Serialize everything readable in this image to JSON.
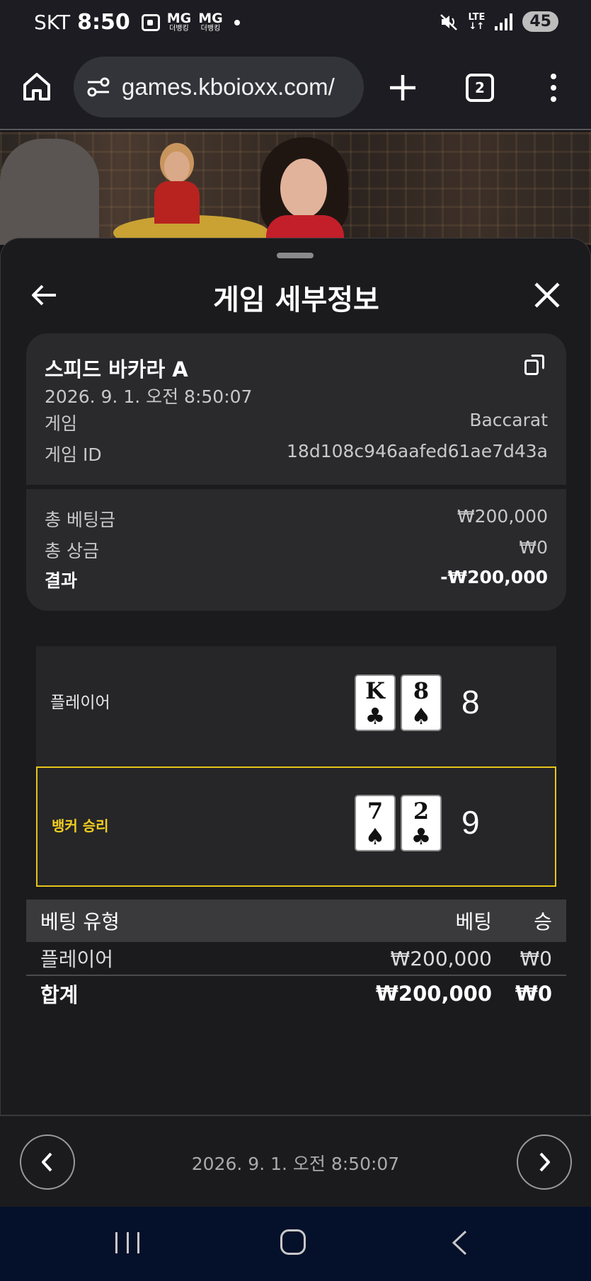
{
  "status_bar": {
    "carrier": "SKT",
    "time": "8:50",
    "notif_label_1": "MG",
    "notif_label_2": "MG",
    "notif_sub_1": "더뱅킹",
    "notif_sub_2": "더뱅킹",
    "network": "LTE",
    "battery": "45"
  },
  "browser": {
    "url": "games.kboioxx.com/",
    "tab_count": "2",
    "icons": [
      "home-icon",
      "tune-icon",
      "plus-icon",
      "tabs-icon",
      "more-vert-icon"
    ]
  },
  "sheet": {
    "title": "게임 세부정보",
    "icons": [
      "arrow-left-icon",
      "close-icon",
      "copy-icon"
    ]
  },
  "game_info": {
    "name": "스피드 바카라 A",
    "datetime": "2026. 9. 1. 오전 8:50:07",
    "game_label": "게임",
    "game_value": "Baccarat",
    "game_id_label": "게임 ID",
    "game_id_value": "18d108c946aafed61ae7d43a"
  },
  "totals": {
    "total_bet_label": "총 베팅금",
    "total_bet_value": "₩200,000",
    "total_win_label": "총 상금",
    "total_win_value": "₩0",
    "result_label": "결과",
    "result_value": "-₩200,000"
  },
  "hands": {
    "player": {
      "label": "플레이어",
      "cards": [
        {
          "rank": "K",
          "suit": "♣"
        },
        {
          "rank": "8",
          "suit": "♠"
        }
      ],
      "score": "8"
    },
    "banker": {
      "label": "뱅커 승리",
      "cards": [
        {
          "rank": "7",
          "suit": "♠"
        },
        {
          "rank": "2",
          "suit": "♣"
        }
      ],
      "score": "9"
    },
    "winner_color": "#e5c51a"
  },
  "bets_table": {
    "headers": [
      "베팅 유형",
      "베팅",
      "승"
    ],
    "rows": [
      {
        "type": "플레이어",
        "bet": "₩200,000",
        "win": "₩0"
      }
    ],
    "total": {
      "label": "합계",
      "bet": "₩200,000",
      "win": "₩0"
    }
  },
  "footer": {
    "datetime": "2026. 9. 1. 오전 8:50:07",
    "icons": [
      "chevron-left-icon",
      "chevron-right-icon"
    ]
  },
  "system_nav": {
    "icons": [
      "recent-apps-icon",
      "home-circle-icon",
      "back-icon"
    ]
  }
}
